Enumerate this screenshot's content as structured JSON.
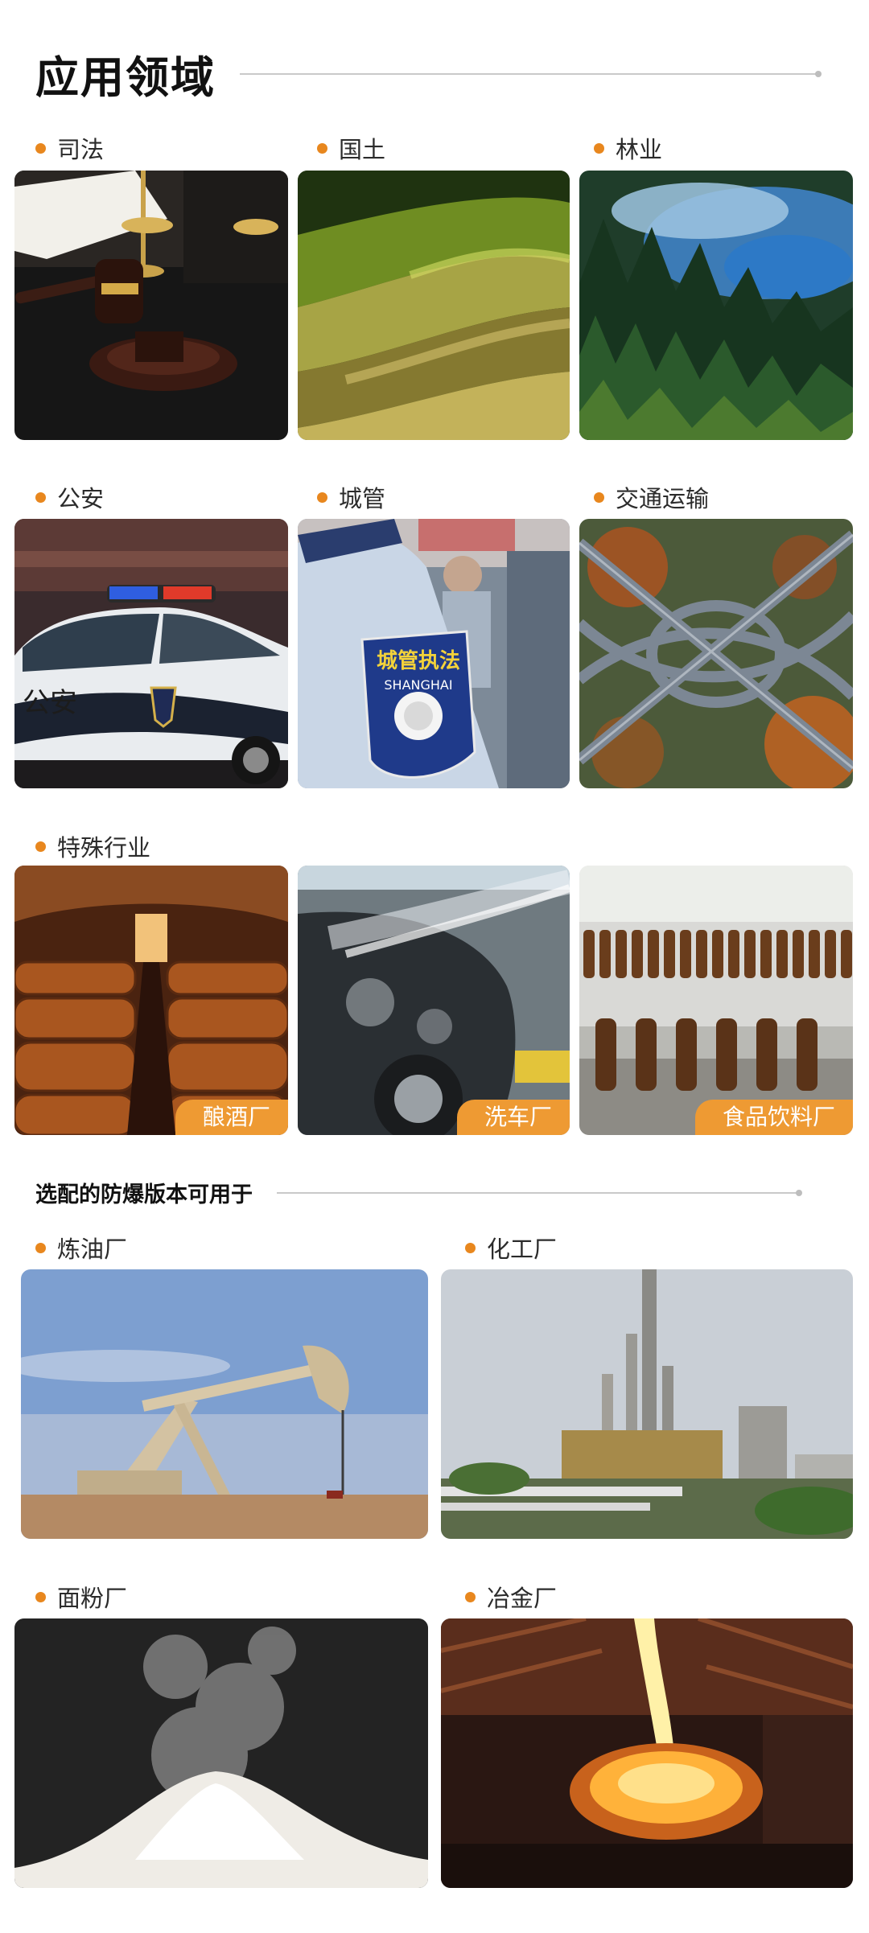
{
  "heading_main": "应用领域",
  "heading_sub": "选配的防爆版本可用于",
  "labels": {
    "judicial": "司法",
    "land": "国土",
    "forestry": "林业",
    "police": "公安",
    "urban": "城管",
    "traffic": "交通运输",
    "special": "特殊行业",
    "refinery": "炼油厂",
    "chemical": "化工厂",
    "flour": "面粉厂",
    "metallurgy": "冶金厂"
  },
  "badges": {
    "brewery": "酿酒厂",
    "carwash": "洗车厂",
    "food": "食品饮料厂"
  },
  "photo_text": {
    "police_car": "公安",
    "urban_patch_top": "城管执法",
    "urban_patch_bottom": "SHANGHAI"
  },
  "colors": {
    "accent_dot": "#e8871e",
    "badge_bg": "#ee9a33"
  }
}
